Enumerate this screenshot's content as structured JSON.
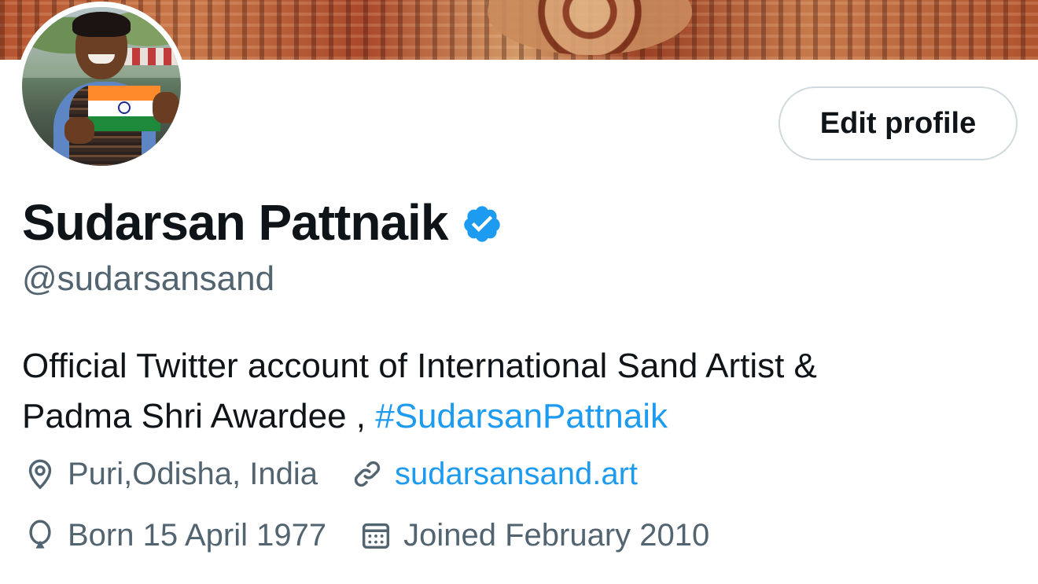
{
  "profile": {
    "name": "Sudarsan Pattnaik",
    "handle": "@sudarsansand",
    "bio_text": "Official Twitter account of International Sand Artist &",
    "bio_text_2": "Padma Shri Awardee , ",
    "bio_hashtag": "#SudarsanPattnaik",
    "verified": true
  },
  "actions": {
    "edit_profile_label": "Edit profile"
  },
  "meta": {
    "location": "Puri,Odisha, India",
    "website": "sudarsansand.art",
    "birth": "Born 15 April 1977",
    "joined": "Joined February 2010"
  },
  "icons": {
    "verified": "verified-badge-icon",
    "location": "location-pin-icon",
    "website": "link-icon",
    "birth": "balloon-icon",
    "joined": "calendar-icon"
  },
  "colors": {
    "accent": "#1d9bf0",
    "text_primary": "#0f1419",
    "text_secondary": "#536471",
    "button_border": "#cfd9de"
  }
}
